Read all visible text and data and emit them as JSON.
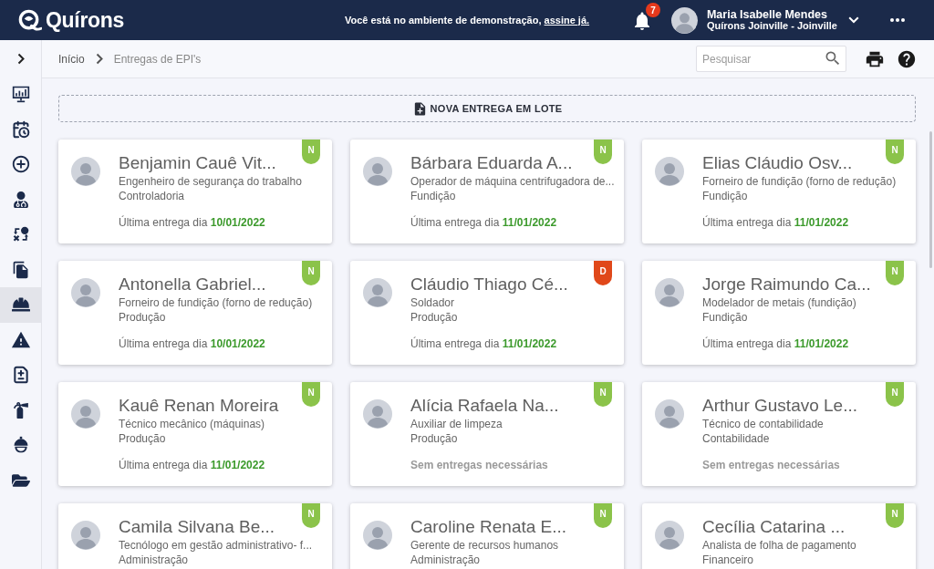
{
  "header": {
    "brand": "Quírons",
    "notice": "Você está no ambiente de demonstração,",
    "notice_link": "assine já.",
    "notification_count": "7",
    "user": {
      "name": "Maria Isabelle Mendes",
      "unit": "Quírons Joinville - Joinville"
    }
  },
  "sidebar": {
    "items": [
      {
        "selected": false
      },
      {
        "selected": false
      },
      {
        "selected": false
      },
      {
        "selected": false
      },
      {
        "selected": false
      },
      {
        "selected": false
      },
      {
        "selected": true
      },
      {
        "selected": false
      },
      {
        "selected": false
      },
      {
        "selected": false
      },
      {
        "selected": false
      },
      {
        "selected": false
      }
    ]
  },
  "breadcrumb": [
    "Início",
    "Entregas de EPI's"
  ],
  "search": {
    "placeholder": "Pesquisar"
  },
  "batch_button": {
    "label": "NOVA ENTREGA EM LOTE"
  },
  "cards": [
    {
      "name": "Benjamin Cauê Vit...",
      "role": "Engenheiro de segurança do trabalho",
      "department": "Controladoria",
      "delivery": {
        "kind": "date",
        "label": "Última entrega dia",
        "date": "10/01/2022"
      },
      "badge": {
        "label": "N",
        "color": "#8bc34a"
      }
    },
    {
      "name": "Bárbara Eduarda A...",
      "role": "Operador de máquina centrifugadora de...",
      "department": "Fundição",
      "delivery": {
        "kind": "date",
        "label": "Última entrega dia",
        "date": "11/01/2022"
      },
      "badge": {
        "label": "N",
        "color": "#8bc34a"
      }
    },
    {
      "name": "Elias Cláudio Osv...",
      "role": "Forneiro de fundição (forno de redução)",
      "department": "Fundição",
      "delivery": {
        "kind": "date",
        "label": "Última entrega dia",
        "date": "11/01/2022"
      },
      "badge": {
        "label": "N",
        "color": "#8bc34a"
      }
    },
    {
      "name": "Antonella Gabriel...",
      "role": "Forneiro de fundição (forno de redução)",
      "department": "Produção",
      "delivery": {
        "kind": "date",
        "label": "Última entrega dia",
        "date": "10/01/2022"
      },
      "badge": {
        "label": "N",
        "color": "#8bc34a"
      }
    },
    {
      "name": "Cláudio Thiago Cé...",
      "role": "Soldador",
      "department": "Produção",
      "delivery": {
        "kind": "date",
        "label": "Última entrega dia",
        "date": "11/01/2022"
      },
      "badge": {
        "label": "D",
        "color": "#e0481a"
      }
    },
    {
      "name": "Jorge Raimundo Ca...",
      "role": "Modelador de metais (fundição)",
      "department": "Fundição",
      "delivery": {
        "kind": "date",
        "label": "Última entrega dia",
        "date": "11/01/2022"
      },
      "badge": {
        "label": "N",
        "color": "#8bc34a"
      }
    },
    {
      "name": "Kauê Renan Moreira",
      "role": "Técnico mecânico (máquinas)",
      "department": "Produção",
      "delivery": {
        "kind": "date",
        "label": "Última entrega dia",
        "date": "11/01/2022"
      },
      "badge": {
        "label": "N",
        "color": "#8bc34a"
      }
    },
    {
      "name": "Alícia Rafaela Na...",
      "role": "Auxiliar de limpeza",
      "department": "Produção",
      "delivery": {
        "kind": "none",
        "text": "Sem entregas necessárias"
      },
      "badge": {
        "label": "N",
        "color": "#8bc34a"
      }
    },
    {
      "name": "Arthur Gustavo Le...",
      "role": "Técnico de contabilidade",
      "department": "Contabilidade",
      "delivery": {
        "kind": "none",
        "text": "Sem entregas necessárias"
      },
      "badge": {
        "label": "N",
        "color": "#8bc34a"
      }
    },
    {
      "name": "Camila Silvana Be...",
      "role": "Tecnólogo em gestão administrativo- f...",
      "department": "Administração",
      "badge": {
        "label": "N",
        "color": "#8bc34a"
      }
    },
    {
      "name": "Caroline Renata E...",
      "role": "Gerente de recursos humanos",
      "department": "Administração",
      "badge": {
        "label": "N",
        "color": "#8bc34a"
      }
    },
    {
      "name": "Cecília Catarina ...",
      "role": "Analista de folha de pagamento",
      "department": "Financeiro",
      "badge": {
        "label": "N",
        "color": "#8bc34a"
      }
    }
  ]
}
